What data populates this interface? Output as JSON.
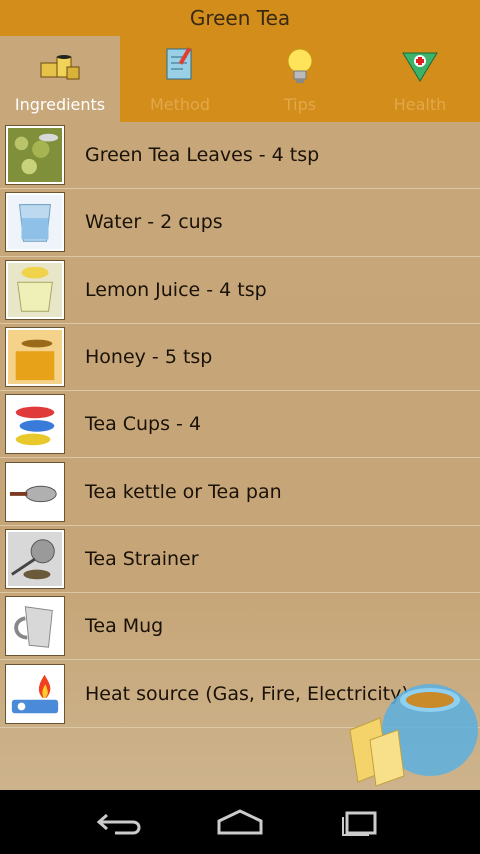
{
  "app": {
    "title": "Green Tea"
  },
  "tabs": [
    {
      "label": "Ingredients",
      "icon": "ingredients-icon",
      "active": true
    },
    {
      "label": "Method",
      "icon": "method-icon",
      "active": false
    },
    {
      "label": "Tips",
      "icon": "lightbulb-icon",
      "active": false
    },
    {
      "label": "Health",
      "icon": "health-icon",
      "active": false
    }
  ],
  "ingredients": [
    {
      "label": "Green Tea Leaves - 4 tsp",
      "icon": "tea-leaves-icon"
    },
    {
      "label": "Water - 2 cups",
      "icon": "water-glass-icon"
    },
    {
      "label": "Lemon Juice - 4 tsp",
      "icon": "lemon-juice-icon"
    },
    {
      "label": "Honey - 5 tsp",
      "icon": "honey-icon"
    },
    {
      "label": "Tea Cups - 4",
      "icon": "tea-cups-icon"
    },
    {
      "label": "Tea kettle or Tea pan",
      "icon": "tea-pan-icon"
    },
    {
      "label": "Tea Strainer",
      "icon": "tea-strainer-icon"
    },
    {
      "label": "Tea Mug",
      "icon": "tea-mug-icon"
    },
    {
      "label": "Heat source (Gas, Fire, Electricity)",
      "icon": "stove-icon"
    }
  ],
  "navbar": {
    "back": "back-icon",
    "home": "home-icon",
    "recents": "recents-icon"
  },
  "colors": {
    "header": "#d28d1b",
    "background": "#c8a77a",
    "active_tab_text": "#ffffff",
    "inactive_tab_text": "#e3a84a"
  }
}
